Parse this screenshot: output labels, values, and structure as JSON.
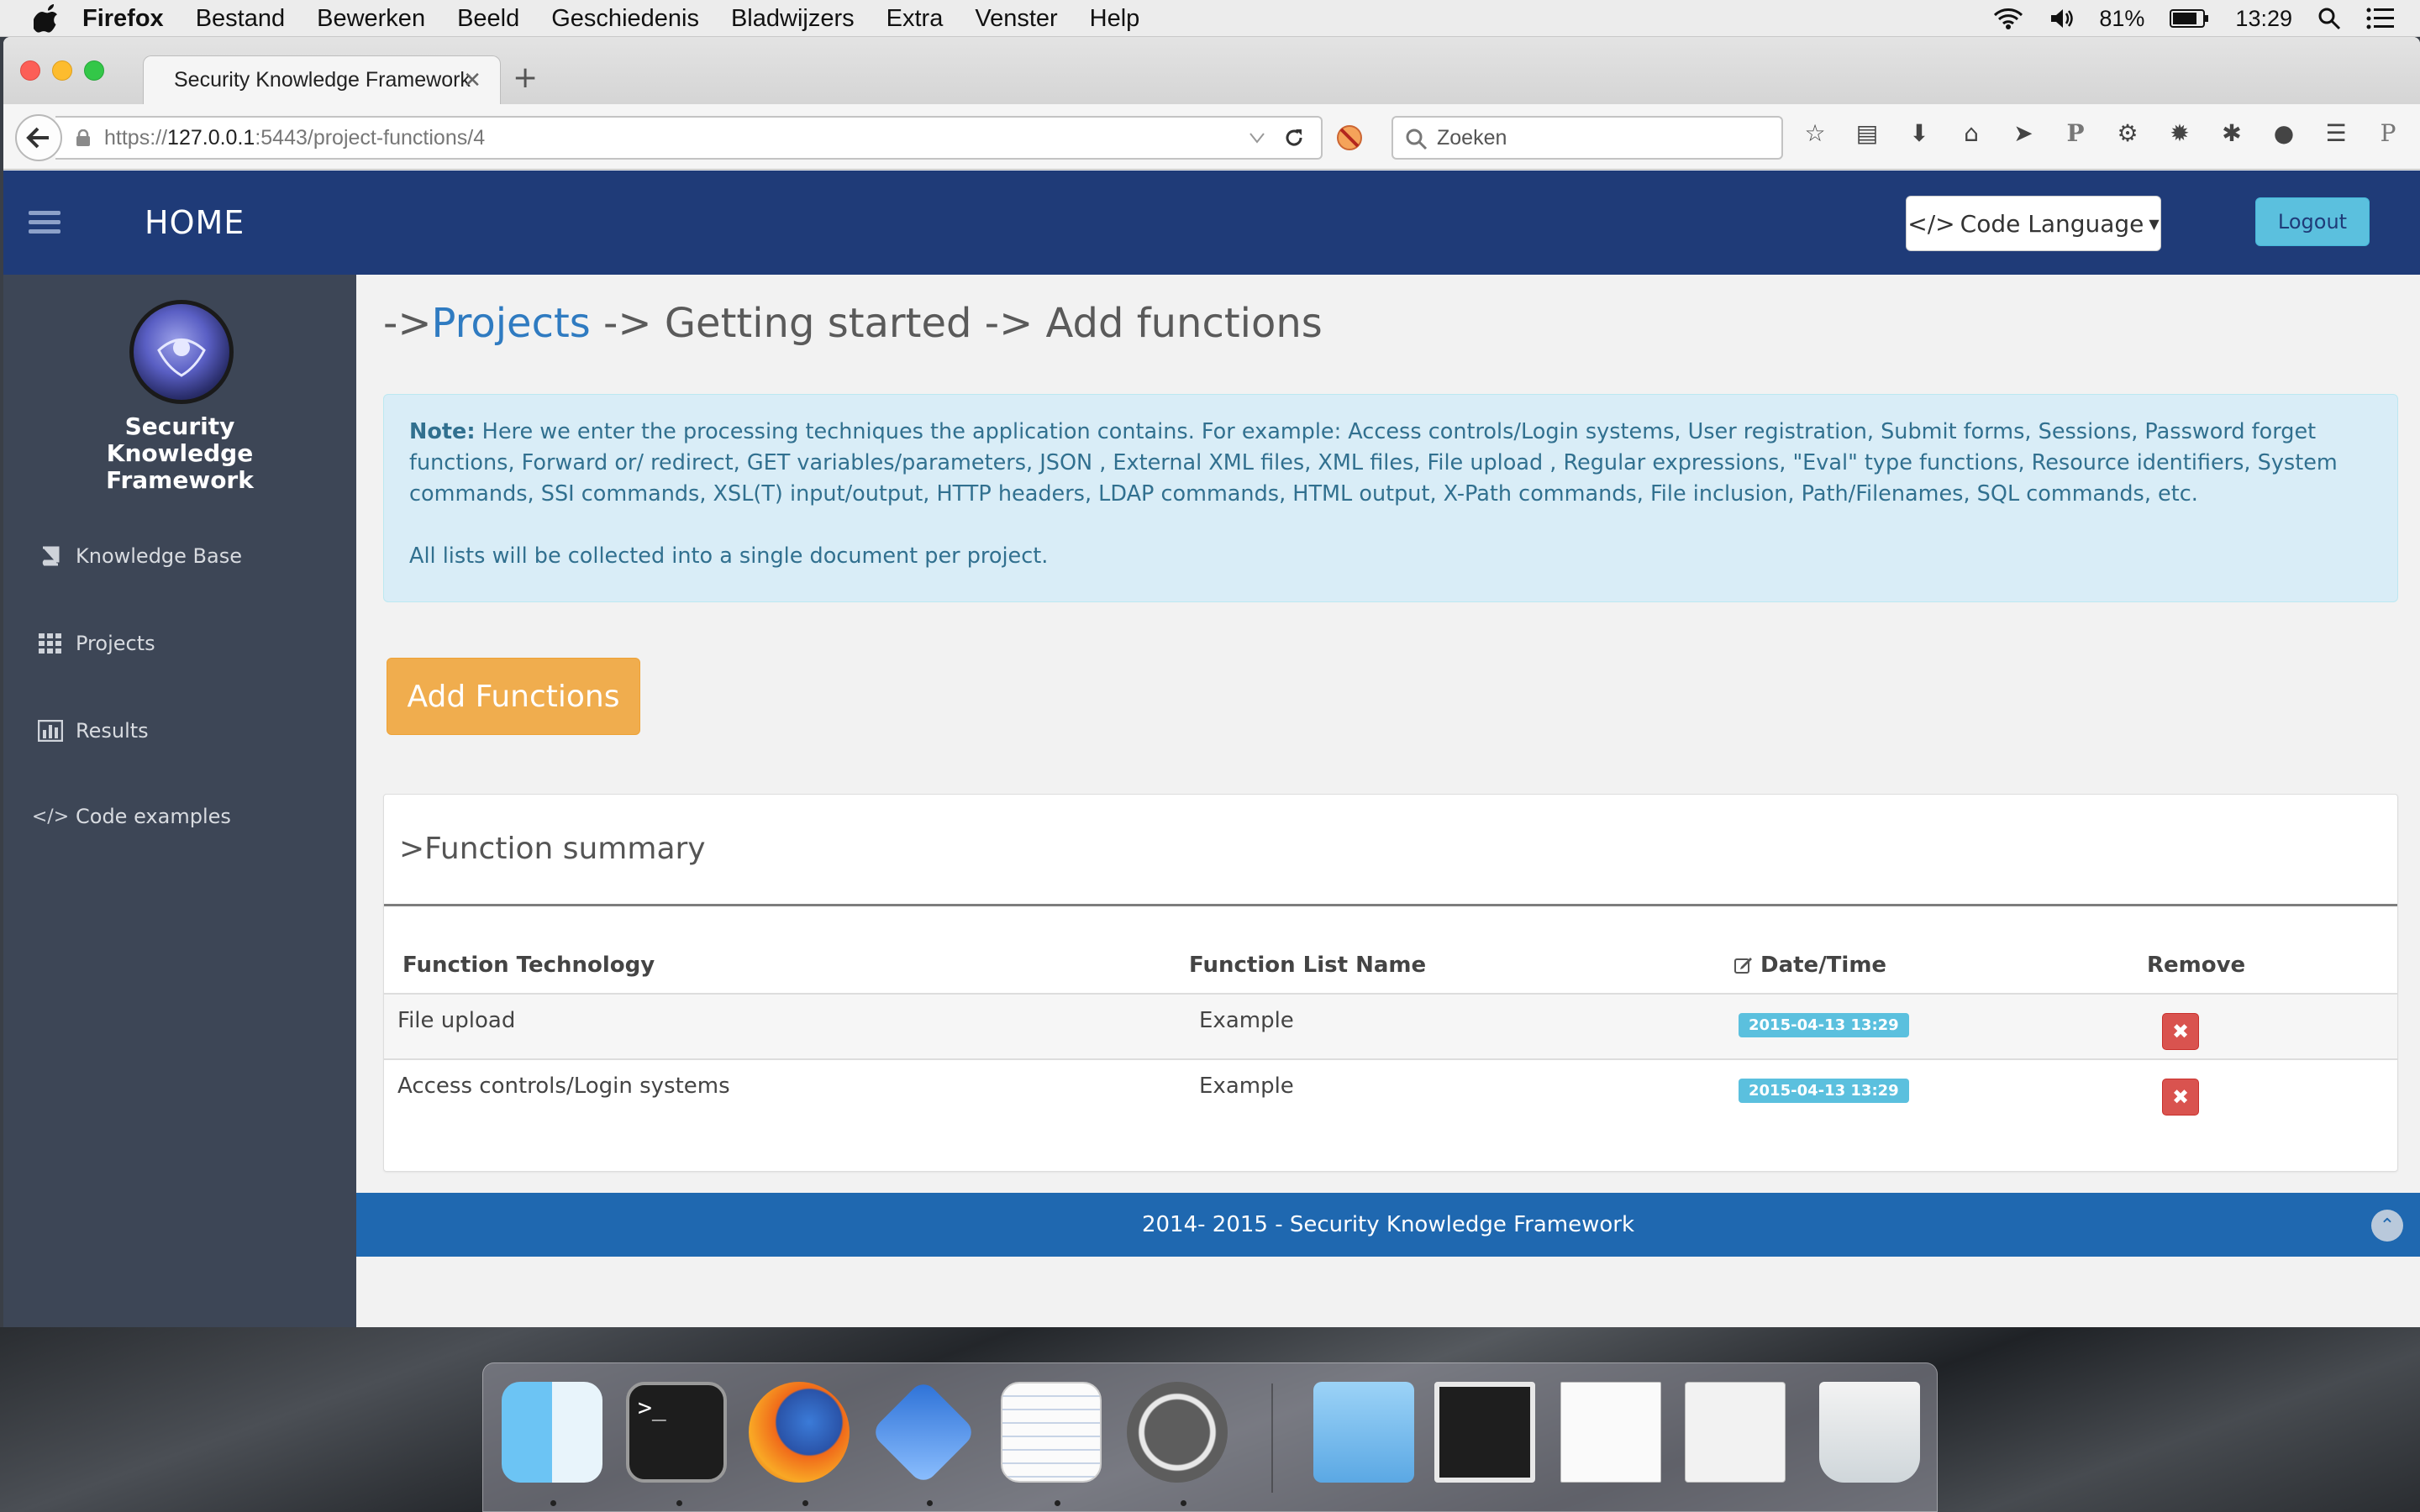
{
  "menubar": {
    "app_name": "Firefox",
    "items": [
      "Bestand",
      "Bewerken",
      "Beeld",
      "Geschiedenis",
      "Bladwijzers",
      "Extra",
      "Venster",
      "Help"
    ],
    "battery": "81%",
    "time": "13:29"
  },
  "browser": {
    "tab_title": "Security Knowledge Framework",
    "url_prefix": "https://",
    "url_host": "127.0.0.1",
    "url_rest": ":5443/project-functions/4",
    "search_placeholder": "Zoeken"
  },
  "topnav": {
    "home": "HOME",
    "code_language": "Code Language",
    "logout": "Logout"
  },
  "sidebar": {
    "brand": "Security Knowledge Framework",
    "items": [
      {
        "label": "Knowledge Base",
        "icon": "book-icon"
      },
      {
        "label": "Projects",
        "icon": "grid-icon"
      },
      {
        "label": "Results",
        "icon": "bar-chart-icon"
      },
      {
        "label": "Code examples",
        "icon": "code-icon"
      }
    ]
  },
  "main": {
    "breadcrumb_prefix": "->",
    "breadcrumb_link": "Projects",
    "breadcrumb_rest": " -> Getting started -> Add functions",
    "note_label": "Note:",
    "note_text": " Here we enter the processing techniques the application contains. For example: Access controls/Login systems, User registration, Submit forms, Sessions, Password forget functions, Forward or/ redirect, GET variables/parameters, JSON , External XML files, XML files, File upload , Regular expressions, \"Eval\" type functions, Resource identifiers, System commands, SSI commands, XSL(T) input/output, HTTP headers, LDAP commands, HTML output, X-Path commands, File inclusion, Path/Filenames, SQL commands, etc.",
    "note_footer": "All lists will be collected into a single document per project.",
    "add_button": "Add Functions",
    "panel_title": ">Function summary",
    "columns": [
      "Function Technology",
      "Function List Name",
      "Date/Time",
      "Remove"
    ],
    "rows": [
      {
        "technology": "File upload",
        "list_name": "Example",
        "datetime": "2015-04-13 13:29"
      },
      {
        "technology": "Access controls/Login systems",
        "list_name": "Example",
        "datetime": "2015-04-13 13:29"
      }
    ],
    "footer": "2014- 2015 - Security Knowledge Framework"
  },
  "colors": {
    "navbar": "#1f3b78",
    "sidebar": "#3d4656",
    "accent_link": "#2f7bc1",
    "add_button": "#f0ad4e",
    "badge": "#5bc0de",
    "remove": "#d9534f",
    "footer": "#1f68b0"
  },
  "dock": [
    "finder-icon",
    "terminal-icon",
    "firefox-icon",
    "bbedit-icon",
    "textedit-icon",
    "mamp-icon",
    "folder-icon",
    "window-thumbnail",
    "document-thumbnail",
    "mamp-window-thumbnail",
    "trash-icon"
  ]
}
